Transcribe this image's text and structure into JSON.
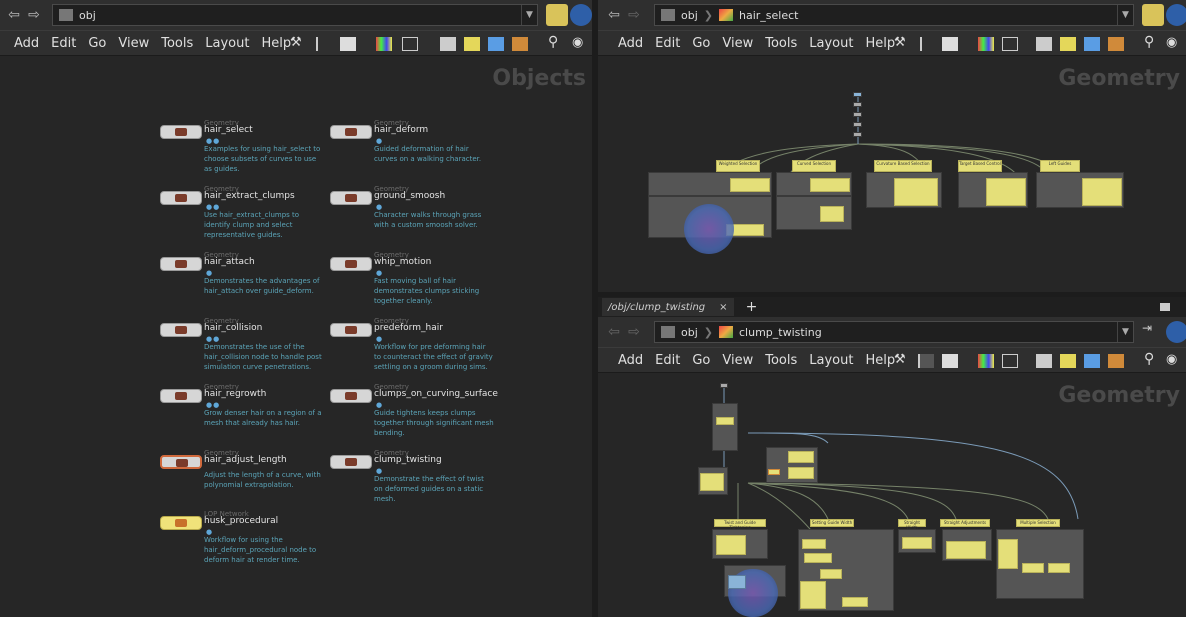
{
  "left": {
    "path": "obj",
    "menu": [
      "Add",
      "Edit",
      "Go",
      "View",
      "Tools",
      "Layout",
      "Help"
    ],
    "context": "Objects",
    "objects": [
      {
        "type": "Geometry",
        "name": "hair_select",
        "desc": "Examples for using hair_select to choose subsets of curves to use as guides."
      },
      {
        "type": "Geometry",
        "name": "hair_deform",
        "desc": "Guided deformation of hair curves on a walking character."
      },
      {
        "type": "Geometry",
        "name": "hair_extract_clumps",
        "desc": "Use hair_extract_clumps to identify clump and select representative guides."
      },
      {
        "type": "Geometry",
        "name": "ground_smoosh",
        "desc": "Character walks through grass with a custom smoosh solver."
      },
      {
        "type": "Geometry",
        "name": "hair_attach",
        "desc": "Demonstrates the advantages of hair_attach over guide_deform."
      },
      {
        "type": "Geometry",
        "name": "whip_motion",
        "desc": "Fast moving ball of hair demonstrates clumps sticking together cleanly."
      },
      {
        "type": "Geometry",
        "name": "hair_collision",
        "desc": "Demonstrates the use of the hair_collision node to handle post simulation curve penetrations."
      },
      {
        "type": "Geometry",
        "name": "predeform_hair",
        "desc": "Workflow for pre deforming hair to counteract the effect of gravity settling on a groom during sims."
      },
      {
        "type": "Geometry",
        "name": "hair_regrowth",
        "desc": "Grow denser hair on a region of a mesh that already has hair."
      },
      {
        "type": "Geometry",
        "name": "clumps_on_curving_surface",
        "desc": "Guide tightens keeps clumps together through significant mesh bending."
      },
      {
        "type": "Geometry",
        "name": "hair_adjust_length",
        "desc": "Adjust the length of a curve, with polynomial extrapolation."
      },
      {
        "type": "Geometry",
        "name": "clump_twisting",
        "desc": "Demonstrate the effect of twist on deformed guides on a static mesh."
      },
      {
        "type": "LOP Network",
        "name": "husk_procedural",
        "desc": "Workflow for using the hair_deform_procedural node to deform hair at render time."
      }
    ]
  },
  "top_right": {
    "path_root": "obj",
    "path_node": "hair_select",
    "menu": [
      "Add",
      "Edit",
      "Go",
      "View",
      "Tools",
      "Layout",
      "Help"
    ],
    "context": "Geometry",
    "group_labels": [
      "Weighted Selection",
      "Curved Selection",
      "Curvature Based Selection",
      "Target Based Control",
      "Left Guides"
    ]
  },
  "bottom_right": {
    "tab_label": "/obj/clump_twisting",
    "tab_close": "×",
    "tab_add": "+",
    "path_root": "obj",
    "path_node": "clump_twisting",
    "menu": [
      "Add",
      "Edit",
      "Go",
      "View",
      "Tools",
      "Layout",
      "Help"
    ],
    "context": "Geometry",
    "group_labels": [
      "Twist and Guide Tightening",
      "Setting Guide Width",
      "Straight Width",
      "Straight Adjustments",
      "Multiple Selection"
    ]
  },
  "colors": {
    "accent": "#e4df79",
    "highlight": "#5fa7d8",
    "panel": "#262626"
  }
}
